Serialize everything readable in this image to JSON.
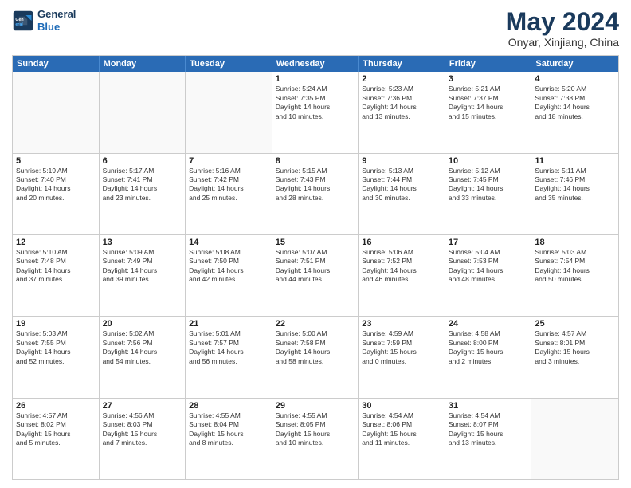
{
  "logo": {
    "line1": "General",
    "line2": "Blue"
  },
  "title": "May 2024",
  "location": "Onyar, Xinjiang, China",
  "days_of_week": [
    "Sunday",
    "Monday",
    "Tuesday",
    "Wednesday",
    "Thursday",
    "Friday",
    "Saturday"
  ],
  "weeks": [
    [
      {
        "day": "",
        "lines": []
      },
      {
        "day": "",
        "lines": []
      },
      {
        "day": "",
        "lines": []
      },
      {
        "day": "1",
        "lines": [
          "Sunrise: 5:24 AM",
          "Sunset: 7:35 PM",
          "Daylight: 14 hours",
          "and 10 minutes."
        ]
      },
      {
        "day": "2",
        "lines": [
          "Sunrise: 5:23 AM",
          "Sunset: 7:36 PM",
          "Daylight: 14 hours",
          "and 13 minutes."
        ]
      },
      {
        "day": "3",
        "lines": [
          "Sunrise: 5:21 AM",
          "Sunset: 7:37 PM",
          "Daylight: 14 hours",
          "and 15 minutes."
        ]
      },
      {
        "day": "4",
        "lines": [
          "Sunrise: 5:20 AM",
          "Sunset: 7:38 PM",
          "Daylight: 14 hours",
          "and 18 minutes."
        ]
      }
    ],
    [
      {
        "day": "5",
        "lines": [
          "Sunrise: 5:19 AM",
          "Sunset: 7:40 PM",
          "Daylight: 14 hours",
          "and 20 minutes."
        ]
      },
      {
        "day": "6",
        "lines": [
          "Sunrise: 5:17 AM",
          "Sunset: 7:41 PM",
          "Daylight: 14 hours",
          "and 23 minutes."
        ]
      },
      {
        "day": "7",
        "lines": [
          "Sunrise: 5:16 AM",
          "Sunset: 7:42 PM",
          "Daylight: 14 hours",
          "and 25 minutes."
        ]
      },
      {
        "day": "8",
        "lines": [
          "Sunrise: 5:15 AM",
          "Sunset: 7:43 PM",
          "Daylight: 14 hours",
          "and 28 minutes."
        ]
      },
      {
        "day": "9",
        "lines": [
          "Sunrise: 5:13 AM",
          "Sunset: 7:44 PM",
          "Daylight: 14 hours",
          "and 30 minutes."
        ]
      },
      {
        "day": "10",
        "lines": [
          "Sunrise: 5:12 AM",
          "Sunset: 7:45 PM",
          "Daylight: 14 hours",
          "and 33 minutes."
        ]
      },
      {
        "day": "11",
        "lines": [
          "Sunrise: 5:11 AM",
          "Sunset: 7:46 PM",
          "Daylight: 14 hours",
          "and 35 minutes."
        ]
      }
    ],
    [
      {
        "day": "12",
        "lines": [
          "Sunrise: 5:10 AM",
          "Sunset: 7:48 PM",
          "Daylight: 14 hours",
          "and 37 minutes."
        ]
      },
      {
        "day": "13",
        "lines": [
          "Sunrise: 5:09 AM",
          "Sunset: 7:49 PM",
          "Daylight: 14 hours",
          "and 39 minutes."
        ]
      },
      {
        "day": "14",
        "lines": [
          "Sunrise: 5:08 AM",
          "Sunset: 7:50 PM",
          "Daylight: 14 hours",
          "and 42 minutes."
        ]
      },
      {
        "day": "15",
        "lines": [
          "Sunrise: 5:07 AM",
          "Sunset: 7:51 PM",
          "Daylight: 14 hours",
          "and 44 minutes."
        ]
      },
      {
        "day": "16",
        "lines": [
          "Sunrise: 5:06 AM",
          "Sunset: 7:52 PM",
          "Daylight: 14 hours",
          "and 46 minutes."
        ]
      },
      {
        "day": "17",
        "lines": [
          "Sunrise: 5:04 AM",
          "Sunset: 7:53 PM",
          "Daylight: 14 hours",
          "and 48 minutes."
        ]
      },
      {
        "day": "18",
        "lines": [
          "Sunrise: 5:03 AM",
          "Sunset: 7:54 PM",
          "Daylight: 14 hours",
          "and 50 minutes."
        ]
      }
    ],
    [
      {
        "day": "19",
        "lines": [
          "Sunrise: 5:03 AM",
          "Sunset: 7:55 PM",
          "Daylight: 14 hours",
          "and 52 minutes."
        ]
      },
      {
        "day": "20",
        "lines": [
          "Sunrise: 5:02 AM",
          "Sunset: 7:56 PM",
          "Daylight: 14 hours",
          "and 54 minutes."
        ]
      },
      {
        "day": "21",
        "lines": [
          "Sunrise: 5:01 AM",
          "Sunset: 7:57 PM",
          "Daylight: 14 hours",
          "and 56 minutes."
        ]
      },
      {
        "day": "22",
        "lines": [
          "Sunrise: 5:00 AM",
          "Sunset: 7:58 PM",
          "Daylight: 14 hours",
          "and 58 minutes."
        ]
      },
      {
        "day": "23",
        "lines": [
          "Sunrise: 4:59 AM",
          "Sunset: 7:59 PM",
          "Daylight: 15 hours",
          "and 0 minutes."
        ]
      },
      {
        "day": "24",
        "lines": [
          "Sunrise: 4:58 AM",
          "Sunset: 8:00 PM",
          "Daylight: 15 hours",
          "and 2 minutes."
        ]
      },
      {
        "day": "25",
        "lines": [
          "Sunrise: 4:57 AM",
          "Sunset: 8:01 PM",
          "Daylight: 15 hours",
          "and 3 minutes."
        ]
      }
    ],
    [
      {
        "day": "26",
        "lines": [
          "Sunrise: 4:57 AM",
          "Sunset: 8:02 PM",
          "Daylight: 15 hours",
          "and 5 minutes."
        ]
      },
      {
        "day": "27",
        "lines": [
          "Sunrise: 4:56 AM",
          "Sunset: 8:03 PM",
          "Daylight: 15 hours",
          "and 7 minutes."
        ]
      },
      {
        "day": "28",
        "lines": [
          "Sunrise: 4:55 AM",
          "Sunset: 8:04 PM",
          "Daylight: 15 hours",
          "and 8 minutes."
        ]
      },
      {
        "day": "29",
        "lines": [
          "Sunrise: 4:55 AM",
          "Sunset: 8:05 PM",
          "Daylight: 15 hours",
          "and 10 minutes."
        ]
      },
      {
        "day": "30",
        "lines": [
          "Sunrise: 4:54 AM",
          "Sunset: 8:06 PM",
          "Daylight: 15 hours",
          "and 11 minutes."
        ]
      },
      {
        "day": "31",
        "lines": [
          "Sunrise: 4:54 AM",
          "Sunset: 8:07 PM",
          "Daylight: 15 hours",
          "and 13 minutes."
        ]
      },
      {
        "day": "",
        "lines": []
      }
    ]
  ]
}
